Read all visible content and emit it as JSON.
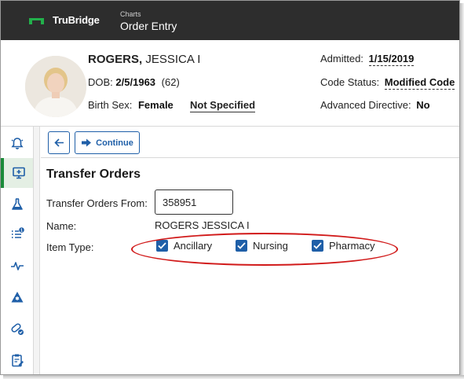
{
  "app": {
    "brand": "TruBridge",
    "breadcrumb_parent": "Charts",
    "page_title": "Order Entry"
  },
  "patient": {
    "last_name": "ROGERS,",
    "first_name": "JESSICA I",
    "dob_label": "DOB:",
    "dob": "2/5/1963",
    "age": "(62)",
    "birth_sex_label": "Birth Sex:",
    "birth_sex": "Female",
    "gender_identity": "Not Specified",
    "admitted_label": "Admitted:",
    "admitted": "1/15/2019",
    "code_status_label": "Code Status:",
    "code_status": "Modified Code",
    "advanced_directive_label": "Advanced Directive:",
    "advanced_directive": "No"
  },
  "sidebar": {
    "items": [
      {
        "icon": "alarm-bell-icon",
        "active": false
      },
      {
        "icon": "monitor-plus-icon",
        "active": true
      },
      {
        "icon": "flask-icon",
        "active": false
      },
      {
        "icon": "list-badge-icon",
        "active": false,
        "badge": "1"
      },
      {
        "icon": "vitals-pulse-icon",
        "active": false
      },
      {
        "icon": "triangle-asterisk-icon",
        "active": false
      },
      {
        "icon": "pill-check-icon",
        "active": false
      },
      {
        "icon": "clipboard-edit-icon",
        "active": false
      }
    ]
  },
  "toolbar": {
    "back_icon": "arrow-left-icon",
    "continue_label": "Continue",
    "continue_icon": "arrow-right-icon"
  },
  "transfer": {
    "title": "Transfer Orders",
    "from_label": "Transfer Orders From:",
    "from_value": "358951",
    "name_label": "Name:",
    "name_value": "ROGERS JESSICA I",
    "item_type_label": "Item Type:",
    "item_types": [
      {
        "label": "Ancillary",
        "checked": true
      },
      {
        "label": "Nursing",
        "checked": true
      },
      {
        "label": "Pharmacy",
        "checked": true
      }
    ]
  },
  "colors": {
    "topbar": "#2d2d2d",
    "accent": "#1f5fa8",
    "active_nav": "#1b8b3a",
    "highlight": "#d11a1a"
  }
}
